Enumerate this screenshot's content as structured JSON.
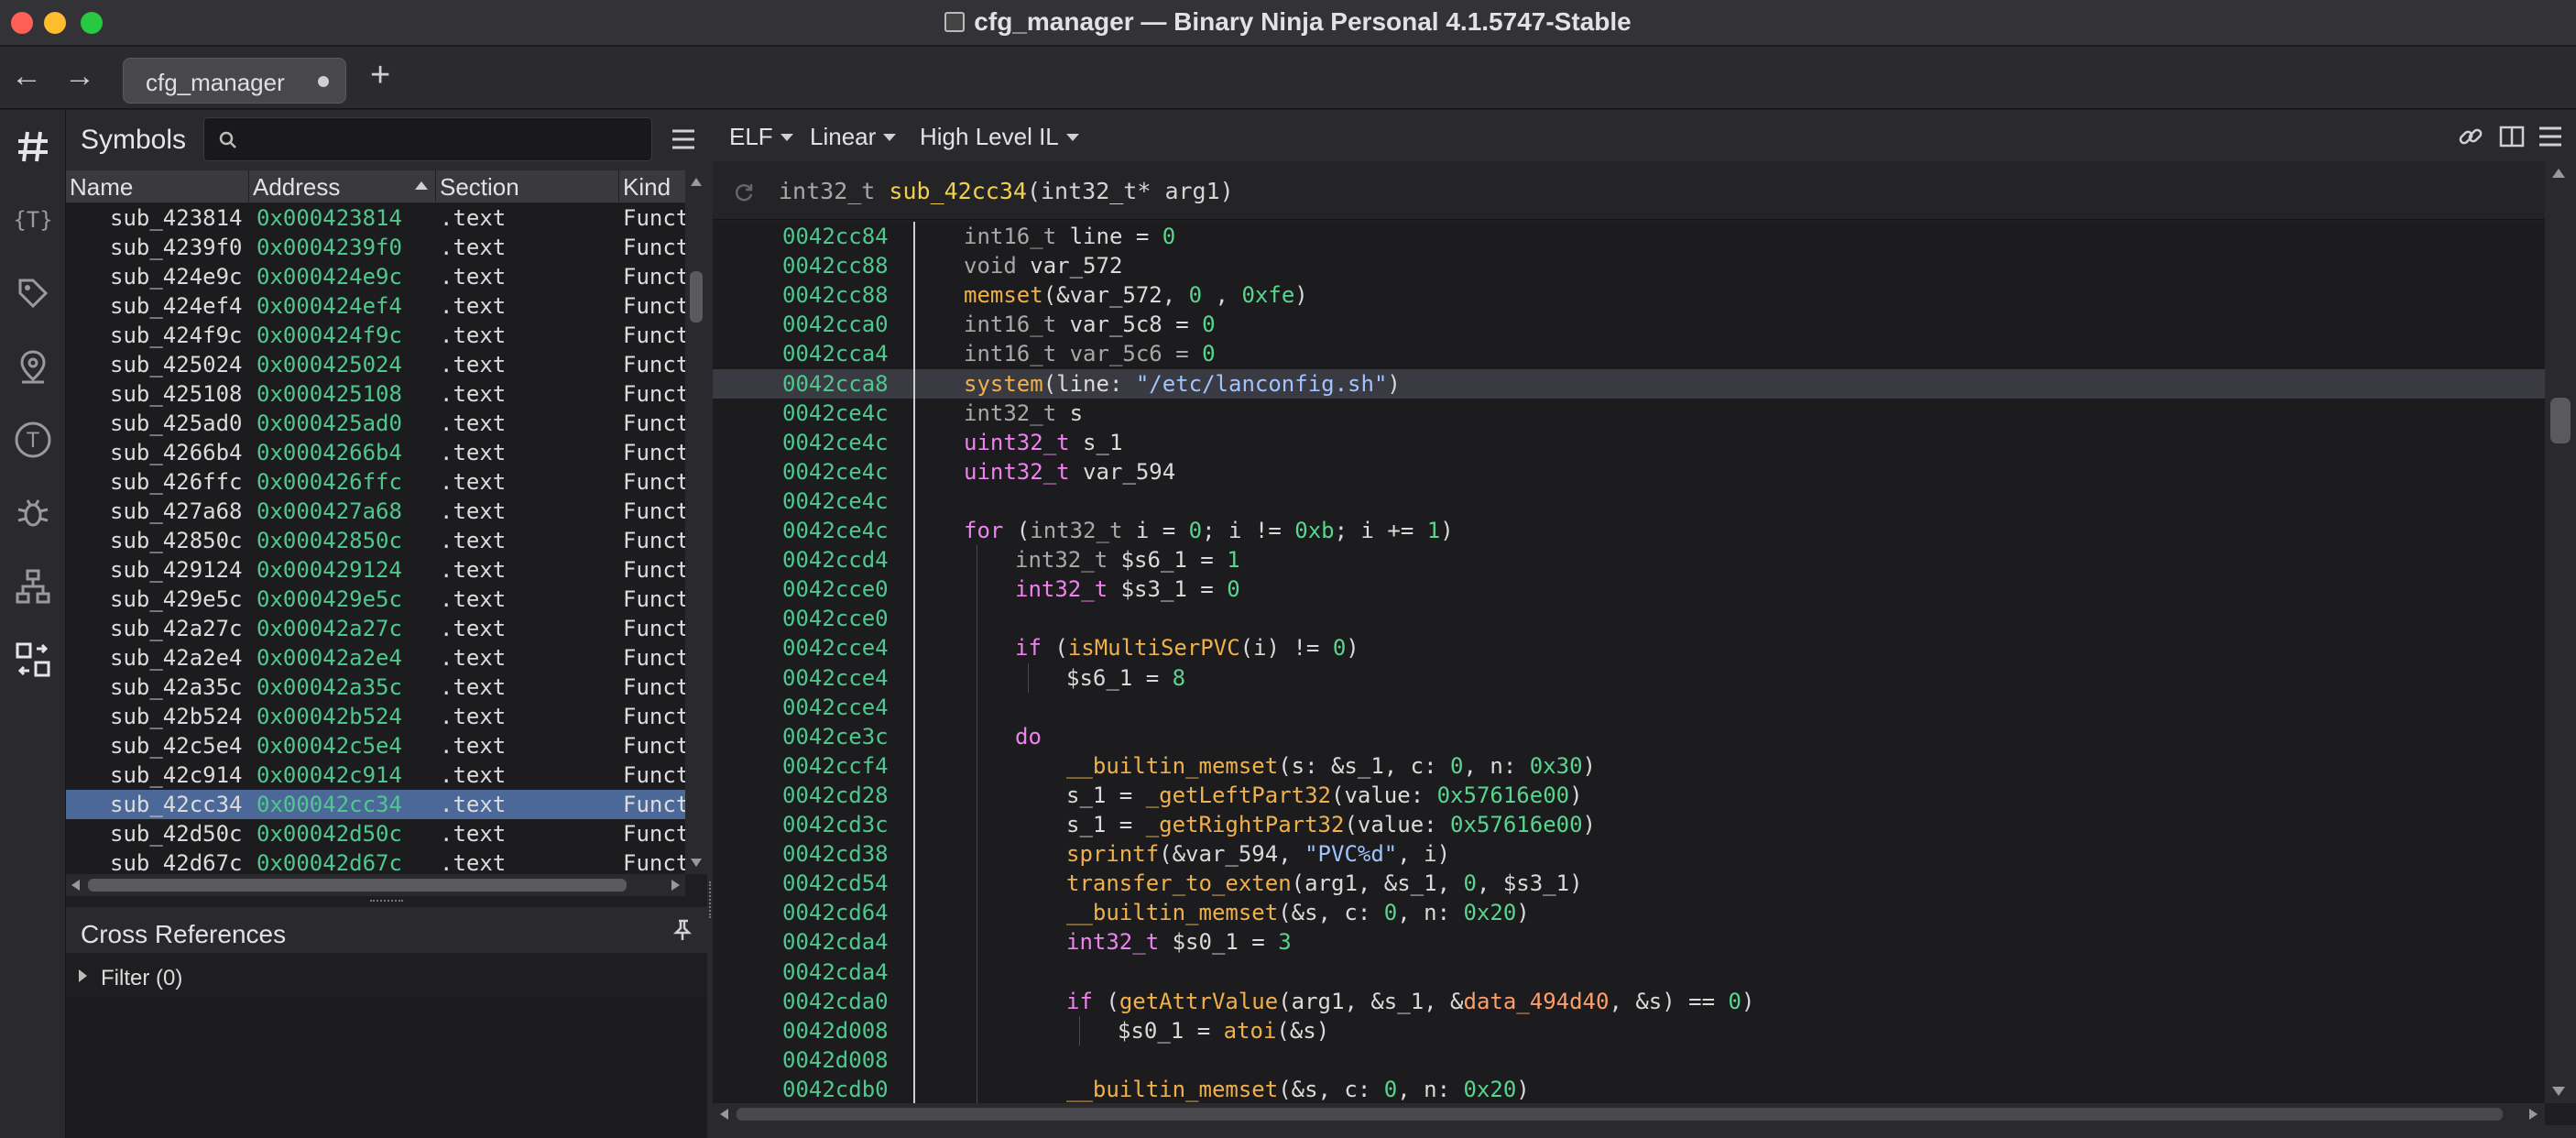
{
  "window": {
    "title": "cfg_manager — Binary Ninja Personal 4.1.5747-Stable"
  },
  "tabs": [
    {
      "label": "cfg_manager"
    }
  ],
  "symbols": {
    "title": "Symbols",
    "search_placeholder": "",
    "columns": [
      "Name",
      "Address",
      "Section",
      "Kind"
    ],
    "rows": [
      {
        "name": "sub_423814",
        "address": "0x000423814",
        "section": ".text",
        "kind": "Funct"
      },
      {
        "name": "sub_4239f0",
        "address": "0x0004239f0",
        "section": ".text",
        "kind": "Funct"
      },
      {
        "name": "sub_424e9c",
        "address": "0x000424e9c",
        "section": ".text",
        "kind": "Funct"
      },
      {
        "name": "sub_424ef4",
        "address": "0x000424ef4",
        "section": ".text",
        "kind": "Funct"
      },
      {
        "name": "sub_424f9c",
        "address": "0x000424f9c",
        "section": ".text",
        "kind": "Funct"
      },
      {
        "name": "sub_425024",
        "address": "0x000425024",
        "section": ".text",
        "kind": "Funct"
      },
      {
        "name": "sub_425108",
        "address": "0x000425108",
        "section": ".text",
        "kind": "Funct"
      },
      {
        "name": "sub_425ad0",
        "address": "0x000425ad0",
        "section": ".text",
        "kind": "Funct"
      },
      {
        "name": "sub_4266b4",
        "address": "0x0004266b4",
        "section": ".text",
        "kind": "Funct"
      },
      {
        "name": "sub_426ffc",
        "address": "0x000426ffc",
        "section": ".text",
        "kind": "Funct"
      },
      {
        "name": "sub_427a68",
        "address": "0x000427a68",
        "section": ".text",
        "kind": "Funct"
      },
      {
        "name": "sub_42850c",
        "address": "0x00042850c",
        "section": ".text",
        "kind": "Funct"
      },
      {
        "name": "sub_429124",
        "address": "0x000429124",
        "section": ".text",
        "kind": "Funct"
      },
      {
        "name": "sub_429e5c",
        "address": "0x000429e5c",
        "section": ".text",
        "kind": "Funct"
      },
      {
        "name": "sub_42a27c",
        "address": "0x00042a27c",
        "section": ".text",
        "kind": "Funct"
      },
      {
        "name": "sub_42a2e4",
        "address": "0x00042a2e4",
        "section": ".text",
        "kind": "Funct"
      },
      {
        "name": "sub_42a35c",
        "address": "0x00042a35c",
        "section": ".text",
        "kind": "Funct"
      },
      {
        "name": "sub_42b524",
        "address": "0x00042b524",
        "section": ".text",
        "kind": "Funct"
      },
      {
        "name": "sub_42c5e4",
        "address": "0x00042c5e4",
        "section": ".text",
        "kind": "Funct"
      },
      {
        "name": "sub_42c914",
        "address": "0x00042c914",
        "section": ".text",
        "kind": "Funct"
      },
      {
        "name": "sub_42cc34",
        "address": "0x00042cc34",
        "section": ".text",
        "kind": "Funct",
        "selected": true
      },
      {
        "name": "sub_42d50c",
        "address": "0x00042d50c",
        "section": ".text",
        "kind": "Funct"
      },
      {
        "name": "sub_42d67c",
        "address": "0x00042d67c",
        "section": ".text",
        "kind": "Funct"
      }
    ]
  },
  "xrefs": {
    "title": "Cross References",
    "filter_label": "Filter (0)"
  },
  "view": {
    "format": "ELF",
    "layout": "Linear",
    "il": "High Level IL"
  },
  "function": {
    "ret_type": "int32_t",
    "name": "sub_42cc34",
    "params": "(int32_t* arg1)"
  },
  "code": [
    {
      "addr": "0042cc84",
      "indent": 0,
      "parts": [
        [
          "t",
          "int16_t "
        ],
        [
          "",
          "line = "
        ],
        [
          "num",
          "0"
        ]
      ]
    },
    {
      "addr": "0042cc88",
      "indent": 0,
      "parts": [
        [
          "t",
          "void "
        ],
        [
          "",
          "var_572"
        ]
      ]
    },
    {
      "addr": "0042cc88",
      "indent": 0,
      "parts": [
        [
          "f",
          "memset"
        ],
        [
          "",
          "(&var_572, "
        ],
        [
          "num",
          "0"
        ],
        [
          "",
          " , "
        ],
        [
          "num",
          "0xfe"
        ],
        [
          "",
          ")"
        ]
      ]
    },
    {
      "addr": "0042cca0",
      "indent": 0,
      "parts": [
        [
          "t",
          "int16_t "
        ],
        [
          "",
          "var_5c8 = "
        ],
        [
          "num",
          "0"
        ]
      ]
    },
    {
      "addr": "0042cca4",
      "indent": 0,
      "parts": [
        [
          "t",
          "int16_t "
        ],
        [
          "t",
          "var_5c6 = "
        ],
        [
          "num",
          "0"
        ]
      ]
    },
    {
      "addr": "0042cca8",
      "indent": 0,
      "hl": true,
      "parts": [
        [
          "f",
          "system"
        ],
        [
          "",
          "(line: "
        ],
        [
          "str",
          "\"/etc/lanconfig.sh\""
        ],
        [
          "",
          ")"
        ]
      ]
    },
    {
      "addr": "0042ce4c",
      "indent": 0,
      "parts": [
        [
          "t",
          "int32_t "
        ],
        [
          "",
          "s"
        ]
      ]
    },
    {
      "addr": "0042ce4c",
      "indent": 0,
      "parts": [
        [
          "ty",
          "uint32_t "
        ],
        [
          "",
          "s_1"
        ]
      ]
    },
    {
      "addr": "0042ce4c",
      "indent": 0,
      "parts": [
        [
          "ty",
          "uint32_t "
        ],
        [
          "",
          "var_594"
        ]
      ]
    },
    {
      "addr": "0042ce4c",
      "indent": 0,
      "parts": []
    },
    {
      "addr": "0042ce4c",
      "indent": 0,
      "parts": [
        [
          "kw",
          "for "
        ],
        [
          "",
          "("
        ],
        [
          "t",
          "int32_t "
        ],
        [
          "",
          "i = "
        ],
        [
          "num",
          "0"
        ],
        [
          "",
          "; i != "
        ],
        [
          "num",
          "0xb"
        ],
        [
          "",
          "; i += "
        ],
        [
          "num",
          "1"
        ],
        [
          "",
          ")"
        ]
      ]
    },
    {
      "addr": "0042ccd4",
      "indent": 1,
      "parts": [
        [
          "t",
          "int32_t "
        ],
        [
          "",
          "$s6_1 = "
        ],
        [
          "num",
          "1"
        ]
      ]
    },
    {
      "addr": "0042cce0",
      "indent": 1,
      "parts": [
        [
          "ty",
          "int32_t "
        ],
        [
          "",
          "$s3_1 = "
        ],
        [
          "num",
          "0"
        ]
      ]
    },
    {
      "addr": "0042cce0",
      "indent": 1,
      "parts": []
    },
    {
      "addr": "0042cce4",
      "indent": 1,
      "parts": [
        [
          "kw",
          "if "
        ],
        [
          "",
          "("
        ],
        [
          "f",
          "isMultiSerPVC"
        ],
        [
          "",
          "(i) != "
        ],
        [
          "num",
          "0"
        ],
        [
          "",
          ")"
        ]
      ]
    },
    {
      "addr": "0042cce4",
      "indent": 2,
      "parts": [
        [
          "",
          "$s6_1 = "
        ],
        [
          "num",
          "8"
        ]
      ]
    },
    {
      "addr": "0042cce4",
      "indent": 1,
      "parts": []
    },
    {
      "addr": "0042ce3c",
      "indent": 1,
      "parts": [
        [
          "kw",
          "do"
        ]
      ]
    },
    {
      "addr": "0042ccf4",
      "indent": 2,
      "parts": [
        [
          "f",
          "__builtin_memset"
        ],
        [
          "",
          "(s: &s_1, c: "
        ],
        [
          "num",
          "0"
        ],
        [
          "",
          ", n: "
        ],
        [
          "num",
          "0x30"
        ],
        [
          "",
          ")"
        ]
      ]
    },
    {
      "addr": "0042cd28",
      "indent": 2,
      "parts": [
        [
          "",
          "s_1 = "
        ],
        [
          "f",
          "_getLeftPart32"
        ],
        [
          "",
          "(value: "
        ],
        [
          "num",
          "0x57616e00"
        ],
        [
          "",
          ")"
        ]
      ]
    },
    {
      "addr": "0042cd3c",
      "indent": 2,
      "parts": [
        [
          "",
          "s_1 = "
        ],
        [
          "f",
          "_getRightPart32"
        ],
        [
          "",
          "(value: "
        ],
        [
          "num",
          "0x57616e00"
        ],
        [
          "",
          ")"
        ]
      ]
    },
    {
      "addr": "0042cd38",
      "indent": 2,
      "parts": [
        [
          "f",
          "sprintf"
        ],
        [
          "",
          "(&var_594, "
        ],
        [
          "str",
          "\"PVC%d\""
        ],
        [
          "",
          ", i)"
        ]
      ]
    },
    {
      "addr": "0042cd54",
      "indent": 2,
      "parts": [
        [
          "f",
          "transfer_to_exten"
        ],
        [
          "",
          "(arg1, &s_1, "
        ],
        [
          "num",
          "0"
        ],
        [
          "",
          ", $s3_1)"
        ]
      ]
    },
    {
      "addr": "0042cd64",
      "indent": 2,
      "parts": [
        [
          "f",
          "__builtin_memset"
        ],
        [
          "",
          "(&s, c: "
        ],
        [
          "num",
          "0"
        ],
        [
          "",
          ", n: "
        ],
        [
          "num",
          "0x20"
        ],
        [
          "",
          ")"
        ]
      ]
    },
    {
      "addr": "0042cda4",
      "indent": 2,
      "parts": [
        [
          "ty",
          "int32_t "
        ],
        [
          "",
          "$s0_1 = "
        ],
        [
          "num",
          "3"
        ]
      ]
    },
    {
      "addr": "0042cda4",
      "indent": 2,
      "parts": []
    },
    {
      "addr": "0042cda0",
      "indent": 2,
      "parts": [
        [
          "kw",
          "if "
        ],
        [
          "",
          "("
        ],
        [
          "f",
          "getAttrValue"
        ],
        [
          "",
          "(arg1, &s_1, &"
        ],
        [
          "dv",
          "data_494d40"
        ],
        [
          "",
          ", &s) == "
        ],
        [
          "num",
          "0"
        ],
        [
          "",
          ")"
        ]
      ]
    },
    {
      "addr": "0042d008",
      "indent": 3,
      "parts": [
        [
          "",
          "$s0_1 = "
        ],
        [
          "f",
          "atoi"
        ],
        [
          "",
          "(&s)"
        ]
      ]
    },
    {
      "addr": "0042d008",
      "indent": 2,
      "parts": []
    },
    {
      "addr": "0042cdb0",
      "indent": 2,
      "parts": [
        [
          "f",
          "__builtin_memset"
        ],
        [
          "",
          "(&s, c: "
        ],
        [
          "num",
          "0"
        ],
        [
          "",
          ", n: "
        ],
        [
          "num",
          "0x20"
        ],
        [
          "",
          ")"
        ]
      ]
    }
  ]
}
